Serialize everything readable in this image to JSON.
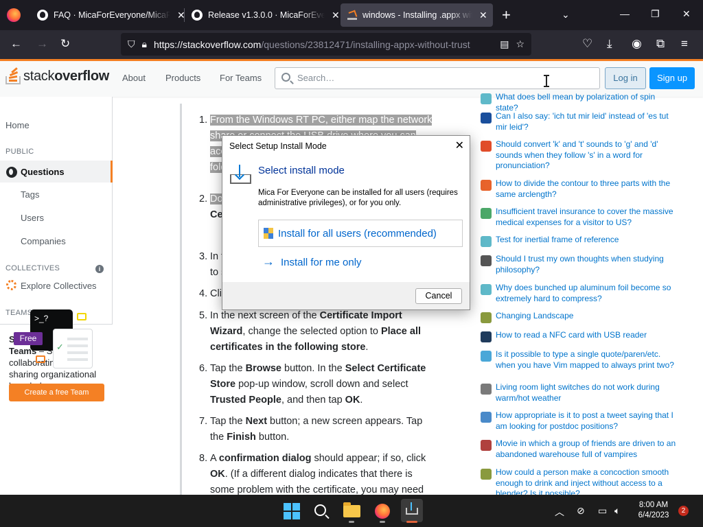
{
  "browser": {
    "tabs": [
      {
        "title": "FAQ · MicaForEveryone/MicaFo",
        "close": "✕"
      },
      {
        "title": "Release v1.3.0.0 · MicaForEveryo",
        "close": "✕"
      },
      {
        "title": "windows - Installing .appx with",
        "close": "✕"
      }
    ],
    "new_tab": "+",
    "url_host": "https://stackoverflow.com",
    "url_path": "/questions/23812471/installing-appx-without-trust"
  },
  "so": {
    "logo_plain": "stack",
    "logo_bold": "overflow",
    "nav": [
      "About",
      "Products",
      "For Teams"
    ],
    "search_placeholder": "Search…",
    "login": "Log in",
    "signup": "Sign up"
  },
  "sidebar": {
    "home": "Home",
    "public": "PUBLIC",
    "questions": "Questions",
    "tags": "Tags",
    "users": "Users",
    "companies": "Companies",
    "collectives": "COLLECTIVES",
    "explore_collectives": "Explore Collectives",
    "teams": "TEAMS",
    "teams_title": "Stack Overflow for Teams",
    "teams_text": " – Start collaborating and sharing organizational knowledge.",
    "terminal": ">_?",
    "free": "Free",
    "cta": "Create a free Team"
  },
  "answer": {
    "steps": [
      {
        "n": "1.",
        "html": "<span class='hl'>From the Windows RT PC, either map the network share or connect the USB drive where you can access the certificate file. Double-tap the app's folder, and then open it.</span>"
      },
      {
        "n": "2.",
        "html": "<span class='hl'>Double-tap</span> the certificate file, and then tap <b>Open</b> in <b>Cer</b>tificate."
      },
      {
        "n": "3.",
        "html": "In the Certificate dialog box, tap <b>Install Certificate</b> to start the wizard."
      },
      {
        "n": "4.",
        "html": "Click Next."
      },
      {
        "n": "5.",
        "html": "In the next screen of the <b>Certificate Import Wizard</b>, change the selected option to <b>Place all certificates in the following store</b>."
      },
      {
        "n": "6.",
        "html": "Tap the <b>Browse</b> button. In the <b>Select Certificate Store</b> pop-up window, scroll down and select <b>Trusted People</b>, and then tap <b>OK</b>."
      },
      {
        "n": "7.",
        "html": "Tap the <b>Next</b> button; a new screen appears. Tap the <b>Finish</b> button."
      },
      {
        "n": "8.",
        "html": "A <b>confirmation dialog</b> should appear; if so, click <b>OK</b>. (If a different dialog indicates that there is some problem with the certificate, you may need"
      }
    ]
  },
  "hot_questions": [
    {
      "text": "What does bell mean by polarization of spin state?",
      "icon": "physics-icon",
      "color": "#5fb9c9"
    },
    {
      "text": "Can I also say: 'ich tut mir leid' instead of 'es tut mir leid'?",
      "icon": "german-icon",
      "color": "#1a4f9c"
    },
    {
      "text": "Should convert 'k' and 't' sounds to 'g' and 'd' sounds when they follow 's' in a word for pronunciation?",
      "icon": "bookmark-icon",
      "color": "#e14d2a"
    },
    {
      "text": "How to divide the contour to three parts with the same arclength?",
      "icon": "mathematica-icon",
      "color": "#e8632b"
    },
    {
      "text": "Insufficient travel insurance to cover the massive medical expenses for a visitor to US?",
      "icon": "travel-icon",
      "color": "#4ca869"
    },
    {
      "text": "Test for inertial frame of reference",
      "icon": "physics-icon",
      "color": "#5fb9c9"
    },
    {
      "text": "Should I trust my own thoughts when studying philosophy?",
      "icon": "philosophy-icon",
      "color": "#555555"
    },
    {
      "text": "Why does bunched up aluminum foil become so extremely hard to compress?",
      "icon": "physics-icon",
      "color": "#5fb9c9"
    },
    {
      "text": "Changing Landscape",
      "icon": "worldbuilding-icon",
      "color": "#8a9a3e"
    },
    {
      "text": "How to read a NFC card with USB reader",
      "icon": "unix-icon",
      "color": "#1f3b5c"
    },
    {
      "text": "Is it possible to type a single quote/paren/etc. when you have Vim mapped to always print two?",
      "icon": "vim-icon",
      "color": "#4aa7d8"
    },
    {
      "text": "Living room light switches do not work during warm/hot weather",
      "icon": "diy-icon",
      "color": "#7a7a7a"
    },
    {
      "text": "How appropriate is it to post a tweet saying that I am looking for postdoc positions?",
      "icon": "academia-icon",
      "color": "#4a8ac9"
    },
    {
      "text": "Movie in which a group of friends are driven to an abandoned warehouse full of vampires",
      "icon": "movies-icon",
      "color": "#b0413e"
    },
    {
      "text": "How could a person make a concoction smooth enough to drink and inject without access to a blender? Is it possible?",
      "icon": "worldbuilding-icon",
      "color": "#8a9a3e"
    }
  ],
  "dialog": {
    "title": "Select Setup Install Mode",
    "close": "✕",
    "heading": "Select install mode",
    "desc": "Mica For Everyone can be installed for all users (requires administrative privileges), or for you only.",
    "opt_all": "Install for all users (recommended)",
    "opt_me": "Install for me only",
    "cancel": "Cancel"
  },
  "taskbar": {
    "time": "8:00 AM",
    "date": "6/4/2023",
    "notifications": "2"
  }
}
